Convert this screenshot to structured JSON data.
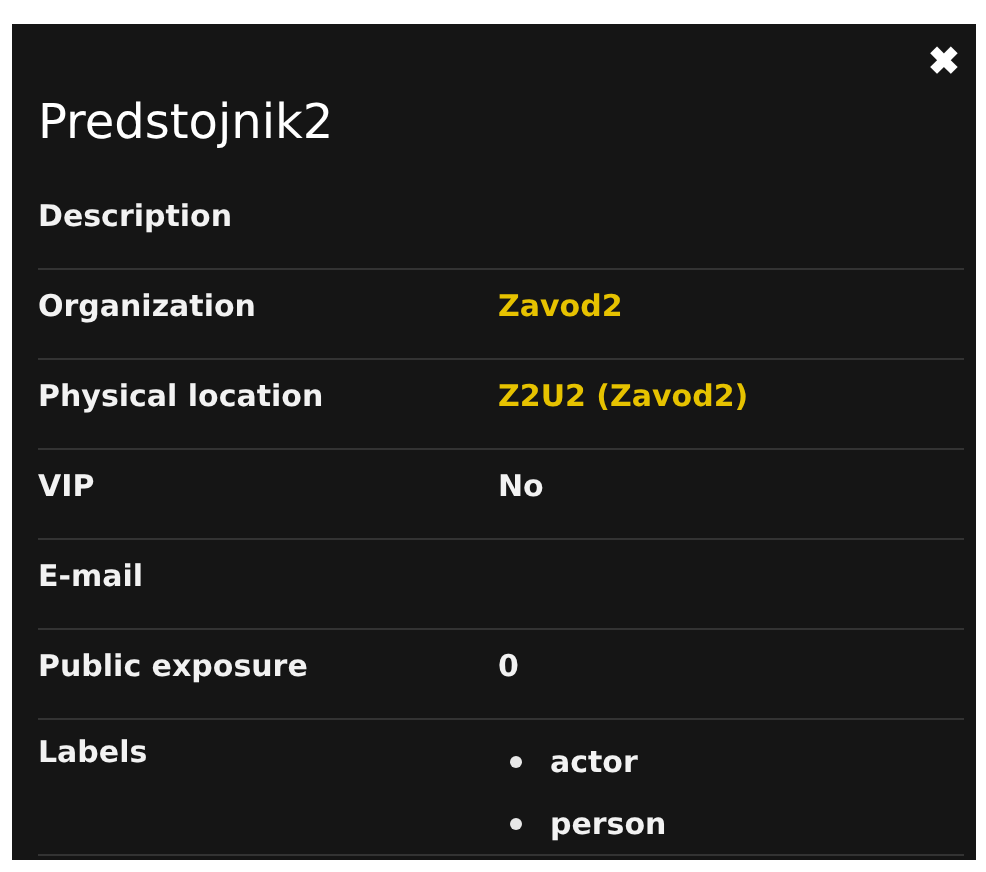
{
  "title": "Predstojnik2",
  "close": "✖",
  "rows": [
    {
      "label": "Description"
    },
    {
      "label": "Organization",
      "value": "Zavod2",
      "kind": "link"
    },
    {
      "label": "Physical location",
      "value": "Z2U2 (Zavod2)",
      "kind": "link"
    },
    {
      "label": "VIP",
      "value": "No",
      "kind": "text"
    },
    {
      "label": "E-mail"
    },
    {
      "label": "Public exposure",
      "value": "0",
      "kind": "text"
    },
    {
      "label": "Labels",
      "items": [
        "actor",
        "person"
      ],
      "kind": "list"
    }
  ]
}
